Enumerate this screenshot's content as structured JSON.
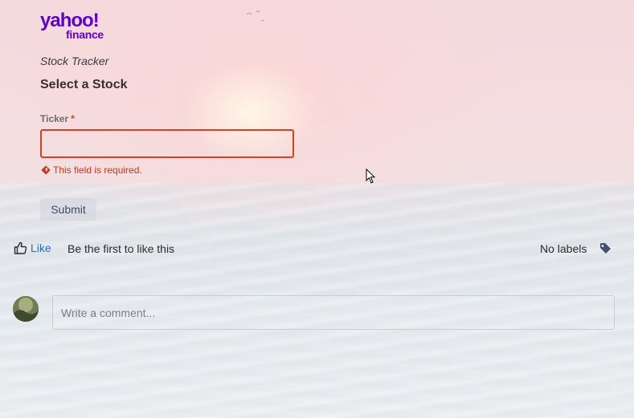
{
  "brand": {
    "logo_word1": "yahoo!",
    "logo_word2": "finance",
    "logo_color": "#6001d2"
  },
  "app": {
    "subtitle": "Stock Tracker"
  },
  "form": {
    "title": "Select a Stock",
    "ticker_label": "Ticker",
    "required_marker": "*",
    "ticker_value": "",
    "error_message": "This field is required.",
    "error_color": "#c9371d",
    "submit_label": "Submit"
  },
  "social": {
    "like_label": "Like",
    "like_hint": "Be the first to like this",
    "labels_text": "No labels",
    "like_color": "#1d6fc9"
  },
  "comment": {
    "placeholder": "Write a comment..."
  },
  "icons": {
    "thumbs_up": "thumbs-up-icon",
    "tag": "tag-icon",
    "error": "error-diamond-icon",
    "cursor": "mouse-pointer-icon"
  }
}
